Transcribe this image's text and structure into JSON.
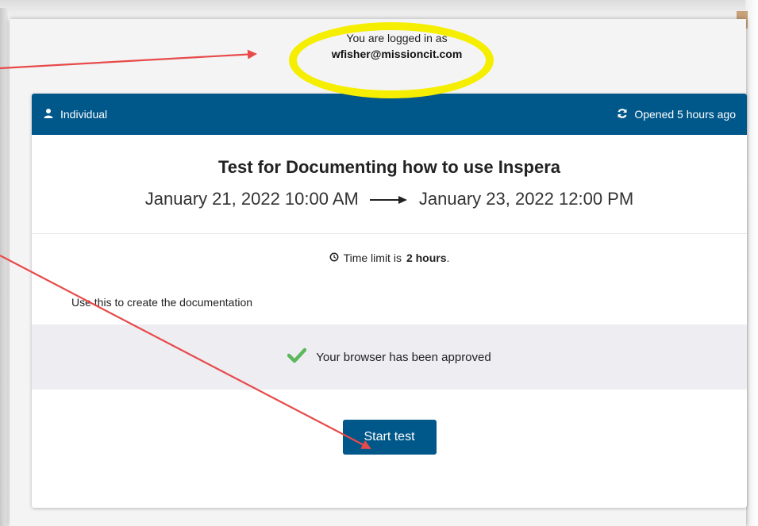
{
  "login": {
    "line1": "You are logged in as",
    "email": "wfisher@missioncit.com"
  },
  "header": {
    "left_icon": "user-icon",
    "left_label": "Individual",
    "right_icon": "refresh-icon",
    "right_label": "Opened 5 hours ago"
  },
  "test": {
    "title": "Test for Documenting how to use Inspera",
    "start": "January 21, 2022 10:00 AM",
    "end": "January 23, 2022 12:00 PM",
    "time_limit_prefix": "Time limit is",
    "time_limit_value": "2 hours",
    "time_limit_suffix": ".",
    "description": "Use this to create the documentation"
  },
  "browser": {
    "icon": "checkmark-icon",
    "status": "Your browser has been approved",
    "check_color": "#5cb85c"
  },
  "actions": {
    "start_label": "Start test"
  },
  "colors": {
    "brand": "#00578a",
    "highlight": "#f5ee00",
    "annotation_arrow": "#e84a4a"
  }
}
